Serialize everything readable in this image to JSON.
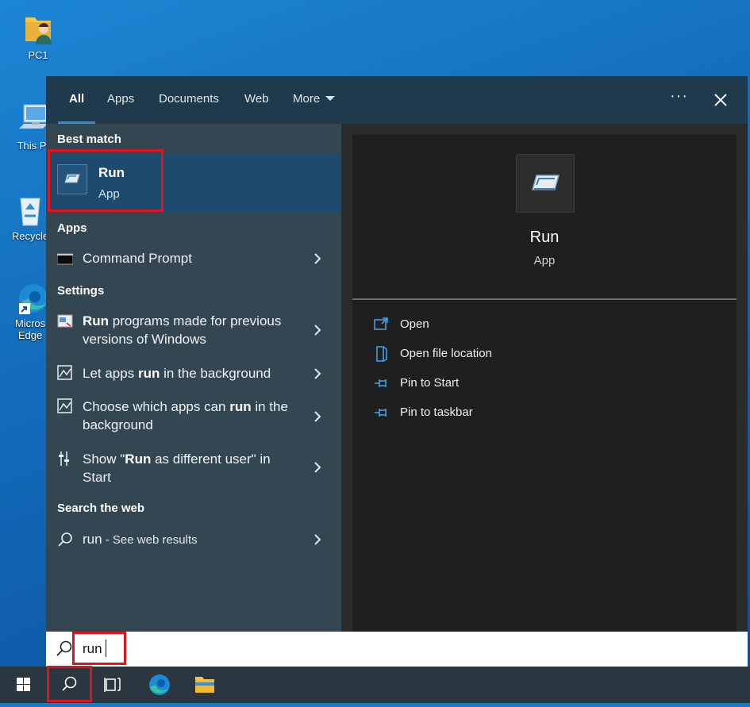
{
  "desktop": {
    "icons": [
      {
        "label": "PC1",
        "icon": "user-folder-icon"
      },
      {
        "label": "This P",
        "icon": "computer-icon"
      },
      {
        "label": "Recycle",
        "icon": "recycle-bin-icon"
      },
      {
        "label": "Micros",
        "label2": "Edge",
        "icon": "edge-shortcut-icon"
      }
    ]
  },
  "search_panel": {
    "tabs": [
      {
        "label": "All",
        "active": true
      },
      {
        "label": "Apps"
      },
      {
        "label": "Documents"
      },
      {
        "label": "Web"
      },
      {
        "label": "More"
      }
    ],
    "more_options": "···",
    "sections": {
      "best_match": "Best match",
      "apps": "Apps",
      "settings": "Settings",
      "search_web": "Search the web"
    },
    "best_match": {
      "name": "Run",
      "type": "App",
      "icon": "run-app-icon"
    },
    "apps": [
      {
        "label": "Command Prompt",
        "icon": "command-prompt-icon"
      }
    ],
    "settings": [
      {
        "pre": "",
        "bold": "Run",
        "post": " programs made for previous versions of Windows",
        "icon": "compatibility-icon"
      },
      {
        "pre": "Let apps ",
        "bold": "run",
        "post": " in the background",
        "icon": "background-apps-icon"
      },
      {
        "pre": "Choose which apps can ",
        "bold": "run",
        "post": " in the background",
        "icon": "background-apps-icon"
      },
      {
        "pre": "Show \"",
        "bold": "Run",
        "post": " as different user\" in Start",
        "icon": "start-settings-icon"
      }
    ],
    "web": {
      "query": "run",
      "suffix": " - See web results",
      "icon": "search-icon"
    },
    "detail": {
      "name": "Run",
      "type": "App",
      "actions": [
        {
          "label": "Open",
          "icon": "open-icon"
        },
        {
          "label": "Open file location",
          "icon": "file-location-icon"
        },
        {
          "label": "Pin to Start",
          "icon": "pin-icon"
        },
        {
          "label": "Pin to taskbar",
          "icon": "pin-icon"
        }
      ]
    }
  },
  "search_box": {
    "value": "run",
    "icon": "search-icon"
  },
  "taskbar": {
    "items": [
      {
        "name": "start-button",
        "icon": "windows-logo-icon"
      },
      {
        "name": "search-button",
        "icon": "search-icon"
      },
      {
        "name": "task-view-button",
        "icon": "task-view-icon"
      },
      {
        "name": "edge-taskbar-button",
        "icon": "edge-icon"
      },
      {
        "name": "file-explorer-button",
        "icon": "folder-icon"
      }
    ]
  },
  "colors": {
    "accent": "#2f8ad7",
    "highlight_box": "#e0141e",
    "best_match_bg": "#1d4a6d",
    "left_pane_bg": "#344652"
  }
}
